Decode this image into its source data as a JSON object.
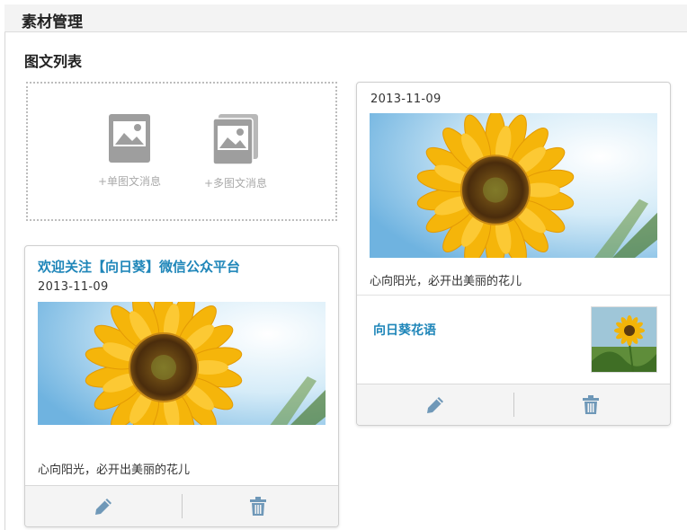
{
  "header": {
    "title": "素材管理"
  },
  "section": {
    "title": "图文列表"
  },
  "add_box": {
    "single": {
      "label": "+单图文消息",
      "icon": "image-icon"
    },
    "multi": {
      "label": "+多图文消息",
      "icon": "images-stack-icon"
    }
  },
  "card_single": {
    "title": "欢迎关注【向日葵】微信公众平台",
    "date": "2013-11-09",
    "description": "心向阳光，必开出美丽的花儿",
    "actions": {
      "edit_icon": "pencil-icon",
      "delete_icon": "trash-icon"
    }
  },
  "card_multi": {
    "date": "2013-11-09",
    "description": "心向阳光，必开出美丽的花儿",
    "sub_items": [
      {
        "title": "向日葵花语"
      }
    ],
    "actions": {
      "edit_icon": "pencil-icon",
      "delete_icon": "trash-icon"
    }
  },
  "colors": {
    "link": "#1f86b9",
    "icon": "#6f98b8",
    "placeholder_icon": "#9e9e9e"
  }
}
